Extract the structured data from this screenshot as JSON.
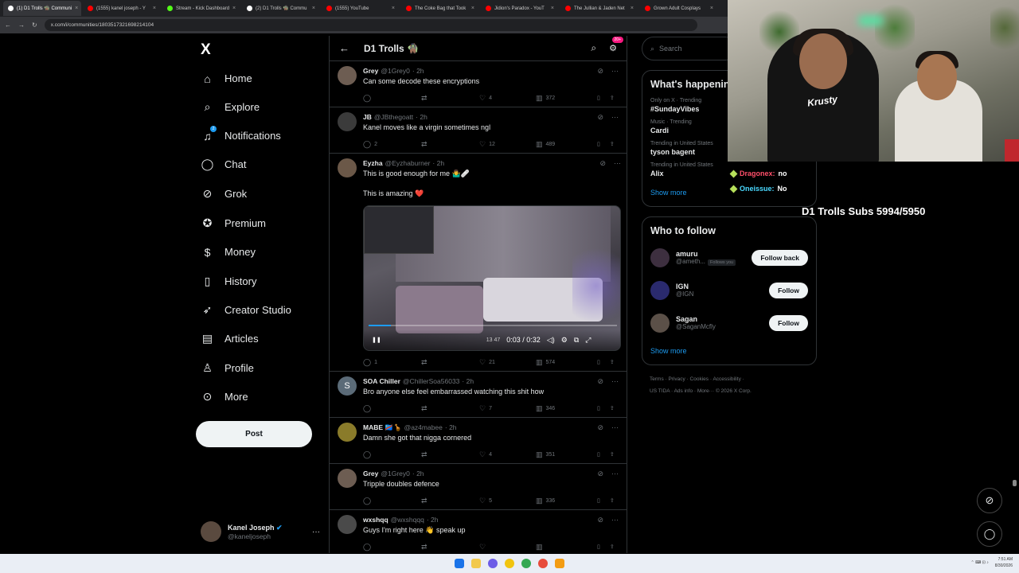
{
  "browser": {
    "tabs": [
      {
        "label": "(1) D1 Trolls 🧌 Communi",
        "color": "#ffffff",
        "active": true
      },
      {
        "label": "(1555) kanel joseph - Y",
        "color": "#ff0000"
      },
      {
        "label": "Stream - Kick Dashboard",
        "color": "#53fc18"
      },
      {
        "label": "(2) D1 Trolls 🧌 Commu",
        "color": "#ffffff"
      },
      {
        "label": "(1555) YouTube",
        "color": "#ff0000"
      },
      {
        "label": "The Coke Bag that Took",
        "color": "#ff0000"
      },
      {
        "label": "Jidion's Paradox - YouT",
        "color": "#ff0000"
      },
      {
        "label": "The Jullian & Jaden Net",
        "color": "#ff0000"
      },
      {
        "label": "Grown Adult Cosplays",
        "color": "#ff0000"
      }
    ],
    "url": "x.com/i/communities/1803517321698214104"
  },
  "sidebar": {
    "logo": "X",
    "items": [
      {
        "label": "Home",
        "icon": "home-icon",
        "glyph": "⌂"
      },
      {
        "label": "Explore",
        "icon": "search-icon",
        "glyph": "⌕"
      },
      {
        "label": "Notifications",
        "icon": "bell-icon",
        "glyph": "♫",
        "badge": "2"
      },
      {
        "label": "Chat",
        "icon": "chat-icon",
        "glyph": "◯"
      },
      {
        "label": "Grok",
        "icon": "grok-icon",
        "glyph": "⊘"
      },
      {
        "label": "Premium",
        "icon": "verified-icon",
        "glyph": "✪"
      },
      {
        "label": "Money",
        "icon": "money-icon",
        "glyph": "$"
      },
      {
        "label": "History",
        "icon": "bookmark-icon",
        "glyph": "▯"
      },
      {
        "label": "Creator Studio",
        "icon": "rocket-icon",
        "glyph": "➶"
      },
      {
        "label": "Articles",
        "icon": "articles-icon",
        "glyph": "▤"
      },
      {
        "label": "Profile",
        "icon": "profile-icon",
        "glyph": "♙"
      },
      {
        "label": "More",
        "icon": "more-icon",
        "glyph": "⊙"
      }
    ],
    "post_label": "Post",
    "account": {
      "name": "Kanel Joseph",
      "handle": "@kaneljoseph",
      "more": "···"
    }
  },
  "main": {
    "title": "D1 Trolls 🧌",
    "header_badge": "20+",
    "tweets": [
      {
        "name": "Grey",
        "handle": "@1Grey0",
        "time": "· 2h",
        "text": "Can some decode these encryptions",
        "replies": "",
        "retweets": "",
        "likes": "4",
        "views": "372",
        "avatar_color": "#6d5d52"
      },
      {
        "name": "JB",
        "handle": "@JBthegoatt",
        "time": "· 2h",
        "text": "Kanel moves like a virgin sometimes ngl",
        "replies": "2",
        "retweets": "",
        "likes": "12",
        "views": "489",
        "avatar_color": "#3b3b3b"
      },
      {
        "name": "Eyzha",
        "handle": "@Eyzhaburner",
        "time": "· 2h",
        "text": "This is good enough for me 🤷‍♂️🩹",
        "text2": "This is amazing ❤️",
        "replies": "1",
        "retweets": "",
        "likes": "21",
        "views": "574",
        "avatar_color": "#6b5848",
        "video": {
          "time": "0:03 / 0:32",
          "progress": 0.09,
          "extra": "13  47"
        }
      },
      {
        "name": "SOA Chiller",
        "handle": "@ChillerSoa56033",
        "time": "· 2h",
        "text": "Bro anyone else feel embarrassed watching this shit how",
        "replies": "",
        "retweets": "",
        "likes": "7",
        "views": "346",
        "avatar_color": "#5b6b78",
        "initial": "S"
      },
      {
        "name": "MABE 🇨🇩🦒",
        "handle": "@az4mabee",
        "time": "· 2h",
        "text": "Damn she got that nigga cornered",
        "replies": "",
        "retweets": "",
        "likes": "4",
        "views": "351",
        "avatar_color": "#8a7b2a"
      },
      {
        "name": "Grey",
        "handle": "@1Grey0",
        "time": "· 2h",
        "text": "Tripple doubles defence",
        "replies": "",
        "retweets": "",
        "likes": "5",
        "views": "336",
        "avatar_color": "#6d5d52"
      },
      {
        "name": "wxshqq",
        "handle": "@wxshqqq",
        "time": "· 2h",
        "text": "Guys I'm right here 👋 speak up",
        "replies": "",
        "retweets": "",
        "likes": "",
        "views": "",
        "avatar_color": "#4a4a4a"
      }
    ]
  },
  "right": {
    "search_placeholder": "Search",
    "happening_title": "What's happening",
    "trends": [
      {
        "meta": "Only on X · Trending",
        "name": "#SundayVibes"
      },
      {
        "meta": "Music · Trending",
        "name": "Cardi"
      },
      {
        "meta": "Trending in United States",
        "name": "tyson bagent"
      },
      {
        "meta": "Trending in United States",
        "name": "Alix"
      }
    ],
    "show_more": "Show more",
    "wtf_title": "Who to follow",
    "follow": [
      {
        "name": "amuru",
        "handle": "@ameth...",
        "follows_you": "Follows you",
        "button": "Follow back",
        "color": "#3d2f3f"
      },
      {
        "name": "IGN",
        "handle": "@IGN",
        "button": "Follow",
        "color": "#2a2a6e"
      },
      {
        "name": "Sagan",
        "handle": "@SaganMcfly",
        "button": "Follow",
        "color": "#5b5048"
      }
    ],
    "show_more2": "Show more",
    "footer1": "Terms · Privacy · Cookies · Accessibility ·",
    "footer2": "US TIDA · Ads info · More··· © 2026 X Corp."
  },
  "overlay": {
    "chat": [
      {
        "user": "Dragonex:",
        "msg": "no",
        "color": "#ff4f6a"
      },
      {
        "user": "Oneissue:",
        "msg": "No",
        "color": "#4ad9ff"
      }
    ],
    "subs": "D1 Trolls Subs 5994/5950",
    "shirt": "Krusty"
  },
  "system": {
    "time": "7:51 AM",
    "date": "8/30/2026"
  }
}
